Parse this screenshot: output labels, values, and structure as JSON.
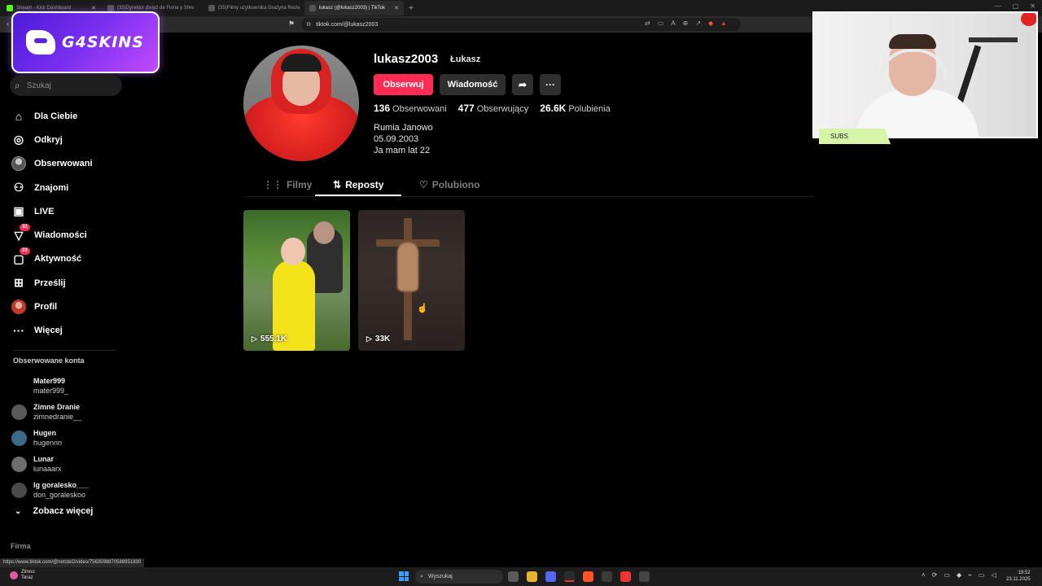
{
  "browser": {
    "tabs": [
      {
        "title": "Stream - Kick Dashboard",
        "active": false
      },
      {
        "title": "(35)Dyrektor diviaz de Fiona y Shre",
        "active": false
      },
      {
        "title": "(35)Filmy użytkownika Grażyna Rezle",
        "active": false
      },
      {
        "title": "łukasz (@łukasz2003) | TikTok",
        "active": true
      }
    ],
    "url": "tiktok.com/@lukasz2003"
  },
  "overlay": {
    "brand_text": "G4SKINS",
    "subs_label": "SUBS"
  },
  "sidebar": {
    "search_placeholder": "Szukaj",
    "nav": [
      {
        "label": "Dla Ciebie",
        "icon": "home-icon"
      },
      {
        "label": "Odkryj",
        "icon": "compass-icon"
      },
      {
        "label": "Obserwowani",
        "icon": "following-avatar-icon"
      },
      {
        "label": "Znajomi",
        "icon": "friends-icon"
      },
      {
        "label": "LIVE",
        "icon": "live-icon"
      },
      {
        "label": "Wiadomości",
        "icon": "messages-icon",
        "badge": "32"
      },
      {
        "label": "Aktywność",
        "icon": "activity-icon",
        "badge": "23"
      },
      {
        "label": "Prześlij",
        "icon": "upload-icon"
      },
      {
        "label": "Profil",
        "icon": "profile-avatar-icon"
      },
      {
        "label": "Więcej",
        "icon": "more-icon"
      }
    ],
    "followed_header": "Obserwowane konta",
    "followed": [
      {
        "name": "Mater999",
        "handle": "mater999_"
      },
      {
        "name": "Zimne Dranie",
        "handle": "zimnedranie__"
      },
      {
        "name": "Hugen",
        "handle": "hugennn"
      },
      {
        "name": "Lunar",
        "handle": "lunaaarx"
      },
      {
        "name": "lg goralesko___",
        "handle": "don_goraleskoo"
      }
    ],
    "see_more": "Zobacz więcej",
    "footer": "Firma"
  },
  "profile": {
    "username": "lukasz2003",
    "nickname": "Łukasz",
    "follow_btn": "Obserwuj",
    "message_btn": "Wiadomość",
    "stats": {
      "following_count": "136",
      "following_label": "Obserwowani",
      "followers_count": "477",
      "followers_label": "Obserwujący",
      "likes_count": "26.6K",
      "likes_label": "Polubienia"
    },
    "bio": [
      "Rumia Janowo",
      "05.09.2003",
      "Ja mam lat 22"
    ],
    "tabs": [
      {
        "label": "Filmy",
        "active": false
      },
      {
        "label": "Reposty",
        "active": true
      },
      {
        "label": "Polubiono",
        "active": false
      }
    ],
    "videos": [
      {
        "views": "555.1K"
      },
      {
        "views": "33K"
      }
    ]
  },
  "status_url": "https://www.tiktok.com/@netstel2/video/7563598870588951830",
  "taskbar": {
    "weather_line1": "Zimno",
    "weather_line2": "Teraz",
    "search_placeholder": "Wyszukaj",
    "time": "19:52",
    "date": "23.11.2025"
  },
  "colors": {
    "accent": "#fe2c55",
    "background": "#000000",
    "button_dark": "#2f2f2f",
    "brand_purple": "#7a2ff0",
    "subs_green": "#d6f5a8"
  }
}
